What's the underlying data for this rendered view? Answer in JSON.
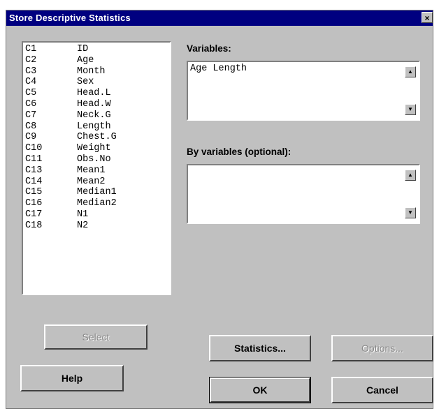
{
  "window": {
    "title": "Store Descriptive Statistics",
    "close_label": "×"
  },
  "columns": [
    {
      "id": "C1",
      "name": "ID"
    },
    {
      "id": "C2",
      "name": "Age"
    },
    {
      "id": "C3",
      "name": "Month"
    },
    {
      "id": "C4",
      "name": "Sex"
    },
    {
      "id": "C5",
      "name": "Head.L"
    },
    {
      "id": "C6",
      "name": "Head.W"
    },
    {
      "id": "C7",
      "name": "Neck.G"
    },
    {
      "id": "C8",
      "name": "Length"
    },
    {
      "id": "C9",
      "name": "Chest.G"
    },
    {
      "id": "C10",
      "name": "Weight"
    },
    {
      "id": "C11",
      "name": "Obs.No"
    },
    {
      "id": "C13",
      "name": "Mean1"
    },
    {
      "id": "C14",
      "name": "Mean2"
    },
    {
      "id": "C15",
      "name": "Median1"
    },
    {
      "id": "C16",
      "name": "Median2"
    },
    {
      "id": "C17",
      "name": "N1"
    },
    {
      "id": "C18",
      "name": "N2"
    }
  ],
  "variables": {
    "label": "Variables:",
    "value": "Age Length"
  },
  "by_variables": {
    "label": "By variables (optional):",
    "value": ""
  },
  "buttons": {
    "select": "Select",
    "help": "Help",
    "statistics": "Statistics...",
    "options": "Options...",
    "ok": "OK",
    "cancel": "Cancel"
  }
}
